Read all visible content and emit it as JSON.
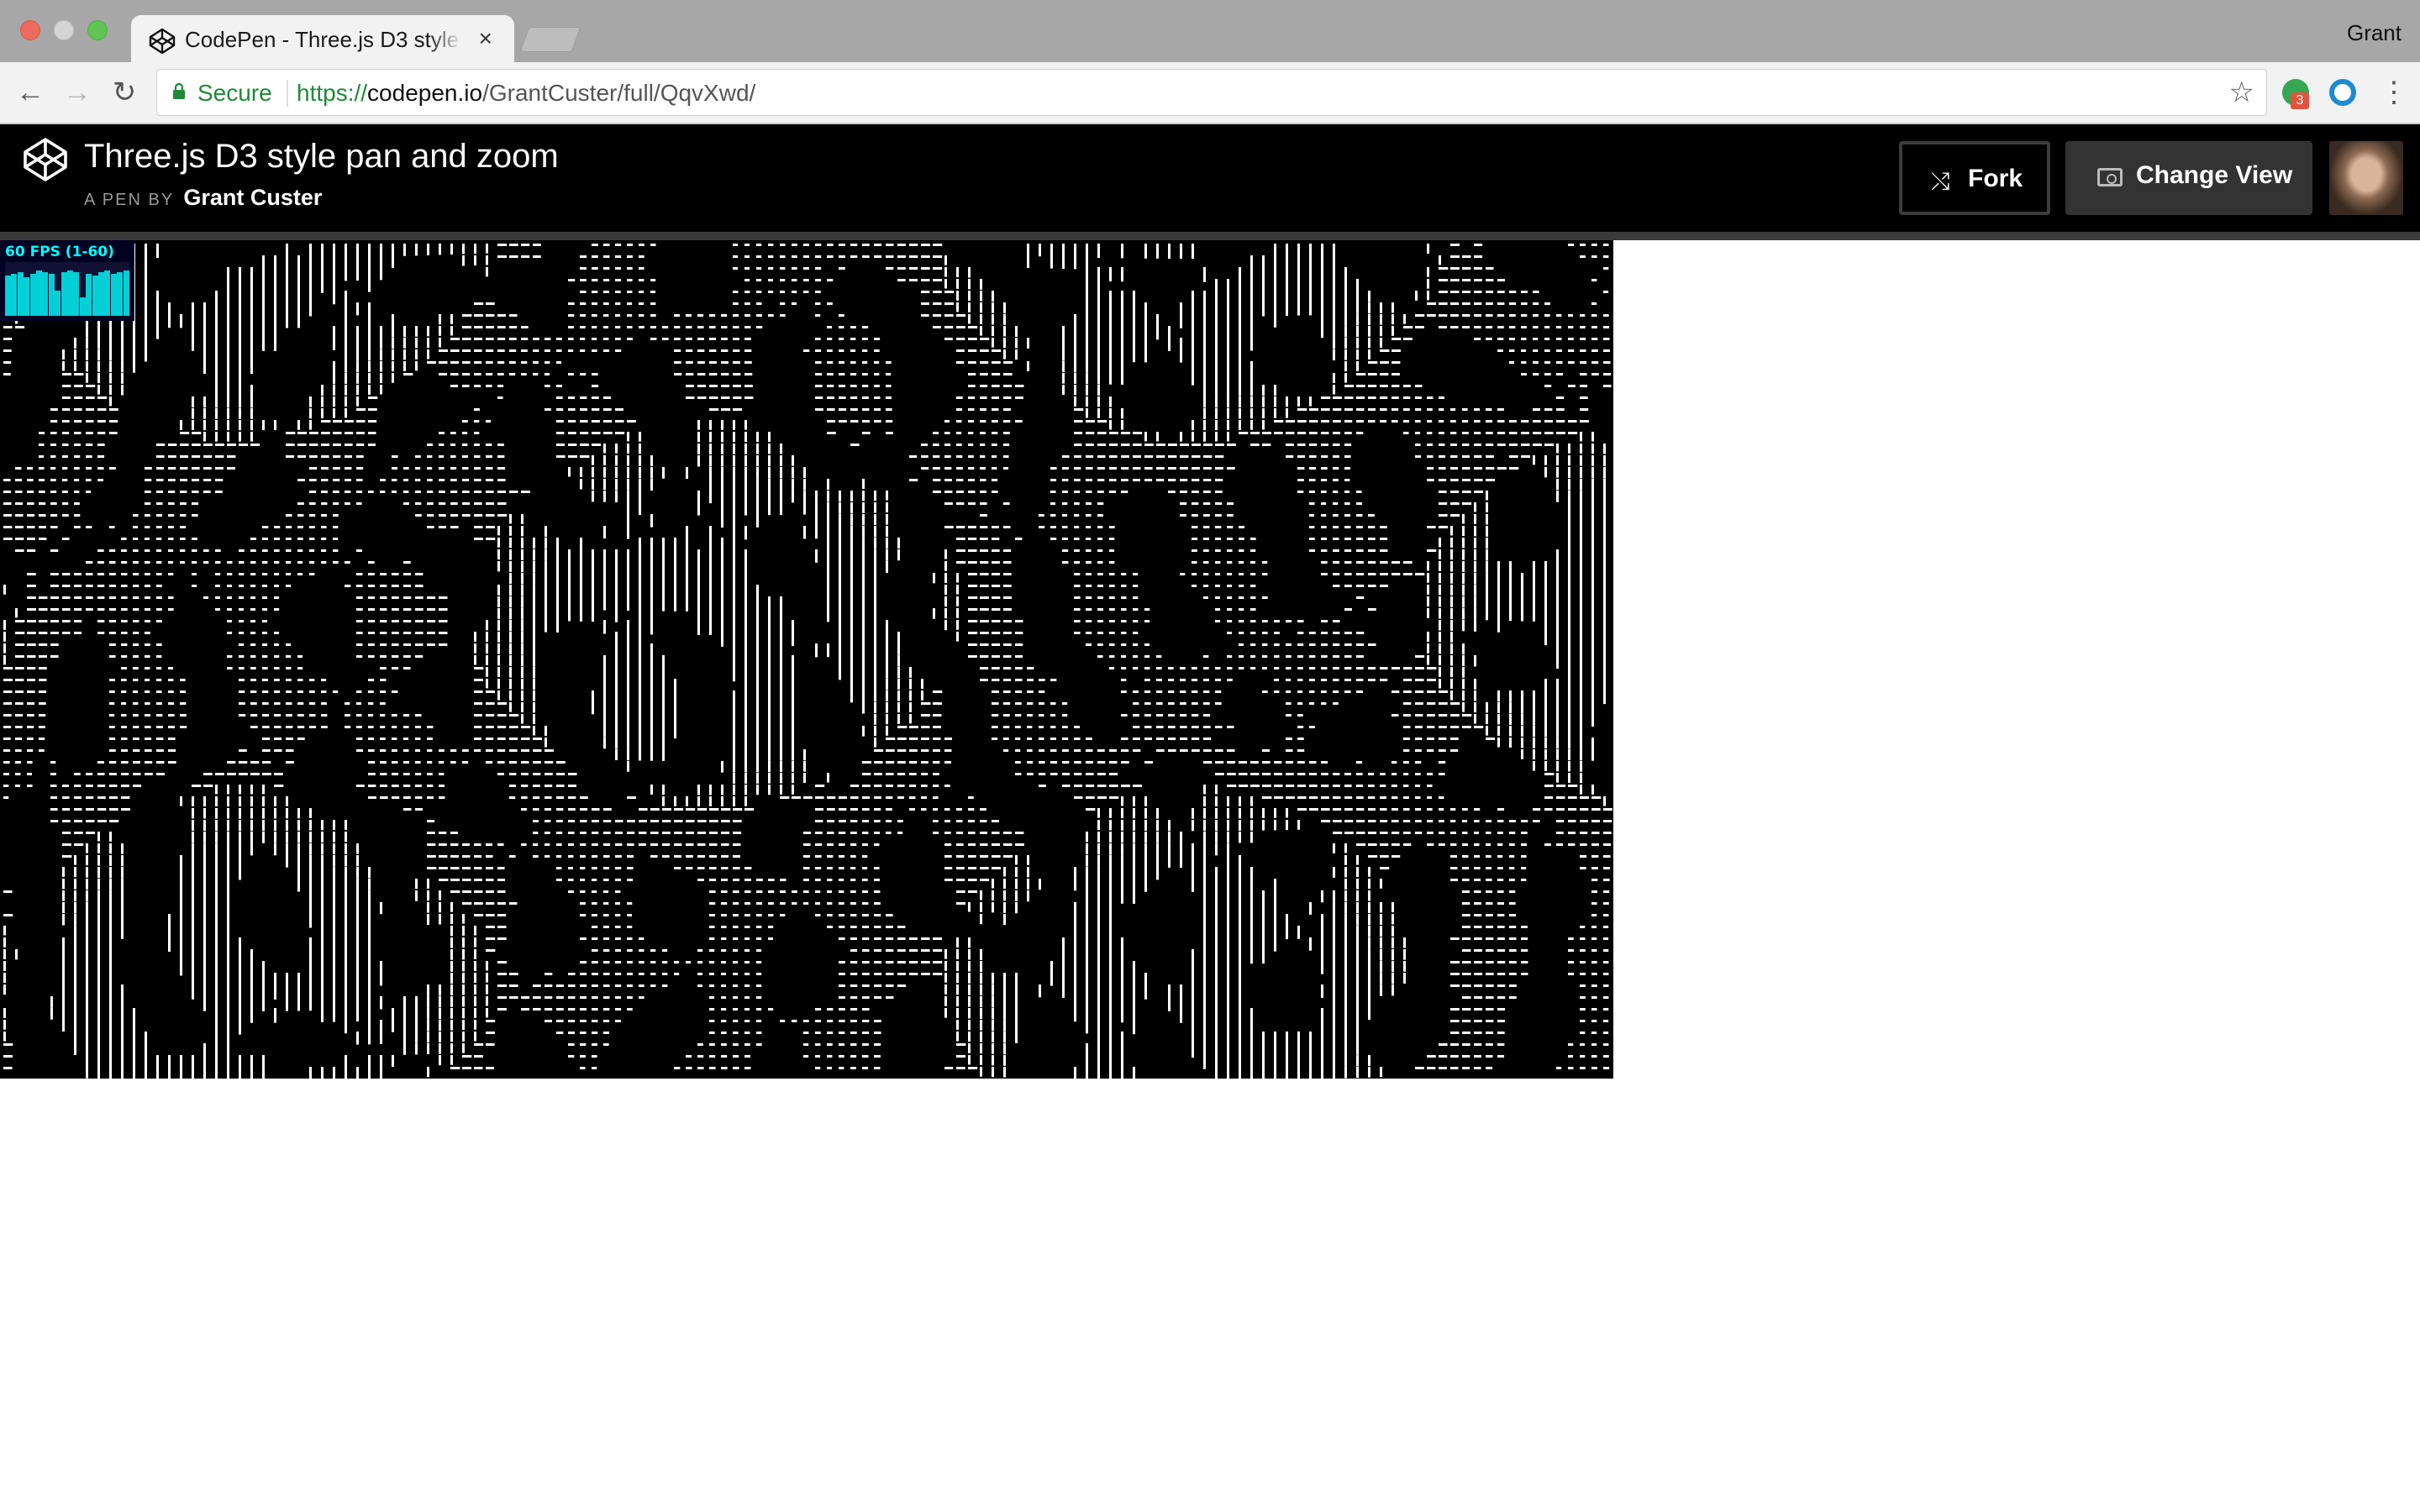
{
  "browser": {
    "tab_title": "CodePen - Three.js D3 style pan and zoom",
    "tab_close": "×",
    "profile_name": "Grant",
    "secure_label": "Secure",
    "url_scheme": "https://",
    "url_host": "codepen.io",
    "url_path": "/GrantCuster/full/QqvXwd/",
    "extension_badge": "3",
    "icons": [
      "back-arrow-icon",
      "forward-arrow-icon",
      "reload-icon",
      "lock-icon",
      "star-icon",
      "menu-dots-icon"
    ]
  },
  "pen": {
    "title": "Three.js D3 style pan and zoom",
    "byline_prefix": "A PEN BY",
    "author": "Grant Custer",
    "fork_label": "Fork",
    "change_view_label": "Change View"
  },
  "stats": {
    "fps_text": "60 FPS (1-60)"
  },
  "colors": {
    "secure_green": "#1e8a3a",
    "codepen_header": "#000000",
    "canvas_background": "#000000",
    "stats_cyan": "#00ffff"
  }
}
